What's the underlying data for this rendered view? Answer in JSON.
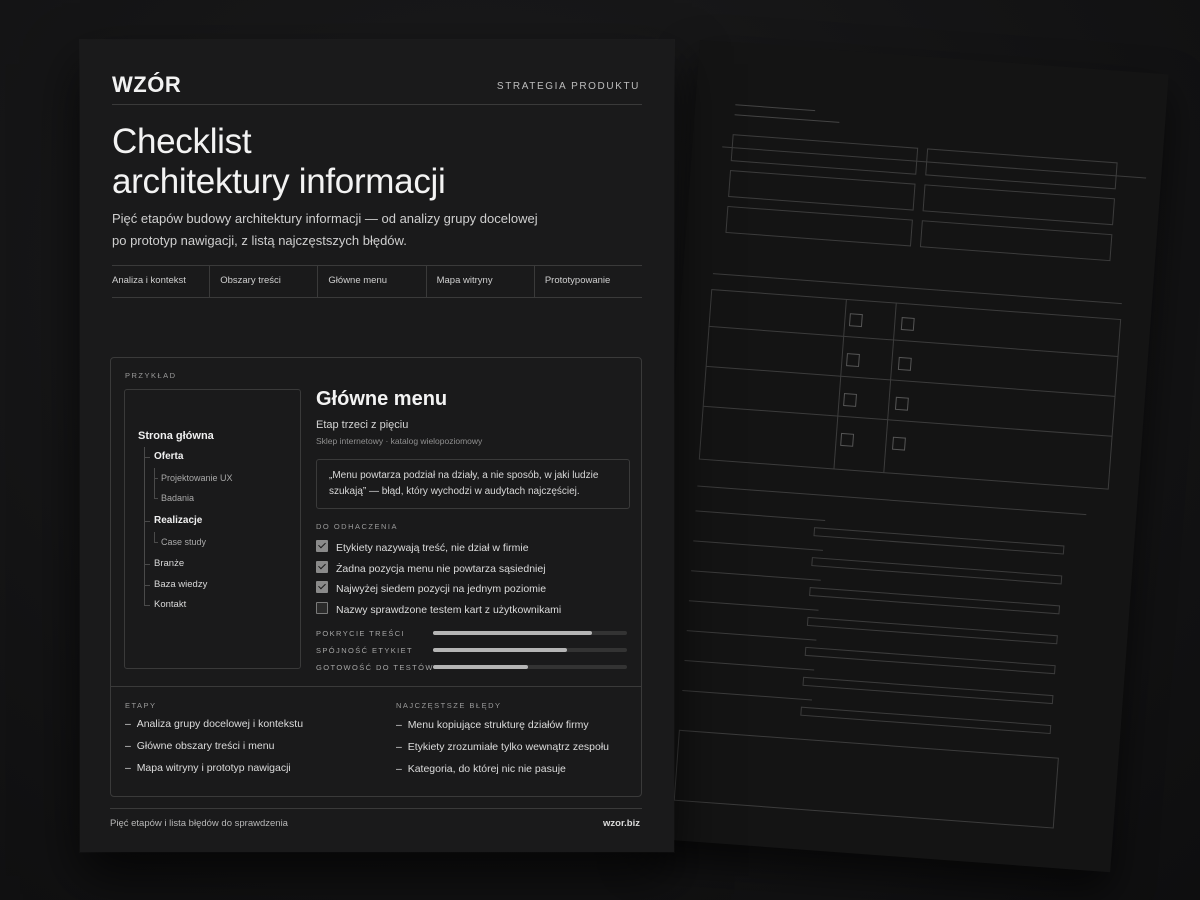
{
  "brand": {
    "logo": "WZÓR",
    "section": "STRATEGIA PRODUKTU"
  },
  "title_line1": "Checklist",
  "title_line2": "architektury informacji",
  "subtitle_line1": "Pięć etapów budowy architektury informacji — od analizy grupy docelowej",
  "subtitle_line2": "po prototyp nawigacji, z listą najczęstszych błędów.",
  "stages": [
    "Analiza i kontekst",
    "Obszary treści",
    "Główne menu",
    "Mapa witryny",
    "Prototypowanie"
  ],
  "example": {
    "label": "PRZYKŁAD",
    "tree": {
      "root": "Strona główna",
      "oferta": "Oferta",
      "projektowanie": "Projektowanie UX",
      "badania": "Badania",
      "realizacje": "Realizacje",
      "case": "Case study",
      "branze": "Branże",
      "baza": "Baza wiedzy",
      "kontakt": "Kontakt"
    },
    "menu_title": "Główne menu",
    "menu_stage": "Etap trzeci z pięciu",
    "menu_context": "Sklep internetowy · katalog wielopoziomowy",
    "quote_line1": "„Menu powtarza podział na działy, a nie sposób, w jaki ludzie",
    "quote_line2": "szukają” — błąd, który wychodzi w audytach najczęściej.",
    "checklist_label": "DO ODHACZENIA",
    "checklist": [
      {
        "text": "Etykiety nazywają treść, nie dział w firmie",
        "checked": true
      },
      {
        "text": "Żadna pozycja menu nie powtarza sąsiedniej",
        "checked": true
      },
      {
        "text": "Najwyżej siedem pozycji na jednym poziomie",
        "checked": true
      },
      {
        "text": "Nazwy sprawdzone testem kart z użytkownikami",
        "checked": false
      }
    ],
    "meters": [
      {
        "label": "POKRYCIE TREŚCI",
        "value": 0.82
      },
      {
        "label": "SPÓJNOŚĆ ETYKIET",
        "value": 0.69
      },
      {
        "label": "GOTOWOŚĆ DO TESTÓW",
        "value": 0.49
      }
    ],
    "stages_label": "ETAPY",
    "stages_list": [
      "Analiza grupy docelowej i kontekstu",
      "Główne obszary treści i menu",
      "Mapa witryny i prototyp nawigacji"
    ],
    "errors_label": "NAJCZĘSTSZE BŁĘDY",
    "errors_list": [
      "Menu kopiujące strukturę działów firmy",
      "Etykiety zrozumiałe tylko wewnątrz zespołu",
      "Kategoria, do której nic nie pasuje"
    ],
    "dash": "–"
  },
  "footer": {
    "left": "Pięć etapów i lista błędów do sprawdzenia",
    "right": "wzor.biz"
  }
}
